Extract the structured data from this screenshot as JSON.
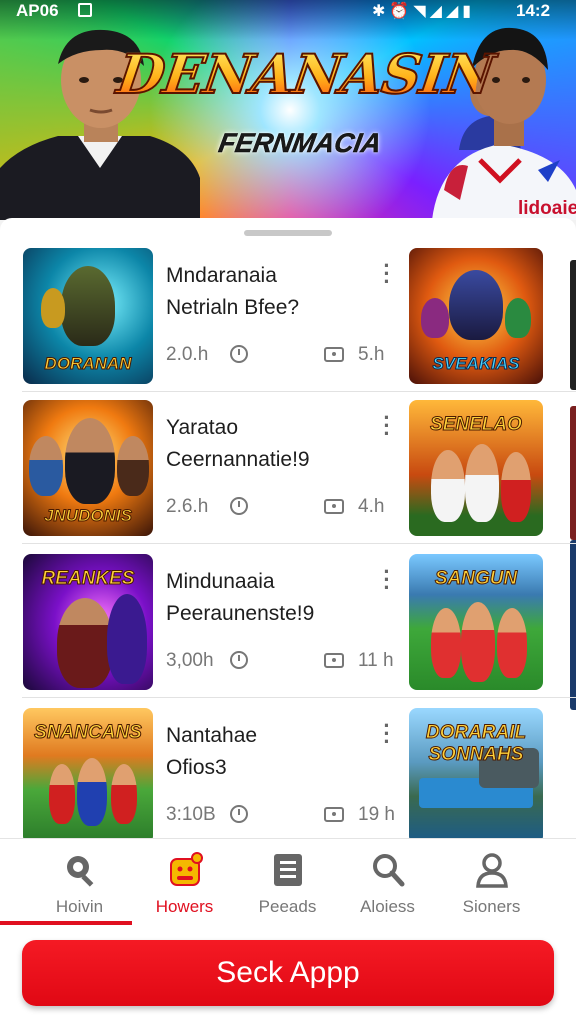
{
  "status_bar": {
    "left_time": "AP06",
    "right_time": "14:2",
    "icons": [
      "bluetooth-icon",
      "alarm-icon",
      "wifi-icon",
      "signal-icon",
      "signal-icon"
    ]
  },
  "hero": {
    "title": "DENANASIN",
    "subtitle": "FERNMACIA",
    "brand": "lidoaie"
  },
  "items": [
    {
      "title": "Mndaranaia",
      "subtitle": "Netrialn Bfee?",
      "meta_left": "2.0.h",
      "meta_right": "5.h",
      "thumb_left_label": "DORANAN",
      "thumb_right_label": "SVEAKIAS"
    },
    {
      "title": "Yaratao",
      "subtitle": "Ceernannatie!9",
      "meta_left": "2.6.h",
      "meta_right": "4.h",
      "thumb_left_label": "JNUDONIS",
      "thumb_right_label": "SENELAO"
    },
    {
      "title": "Mindunaaia",
      "subtitle": "Peeraunenste!9",
      "meta_left": "3,00h",
      "meta_right": "11 h",
      "thumb_left_label": "REANKES",
      "thumb_right_label": "SANGUN"
    },
    {
      "title": "Nantahae",
      "subtitle": "Ofios3",
      "meta_left": "3:10B",
      "meta_right": "19 h",
      "thumb_left_label": "SNANCANS",
      "thumb_right_label": "DORARAIL SONNAHS"
    }
  ],
  "nav": {
    "items": [
      {
        "label": "Hoivin",
        "icon": "gear-search-icon"
      },
      {
        "label": "Howers",
        "icon": "game-character-icon"
      },
      {
        "label": "Peeads",
        "icon": "document-icon"
      },
      {
        "label": "Aloiess",
        "icon": "search-icon"
      },
      {
        "label": "Sioners",
        "icon": "person-icon"
      }
    ],
    "active_index": 1
  },
  "cta": {
    "label": "Seck Appp"
  },
  "colors": {
    "accent": "#e01020",
    "muted_text": "#777777"
  }
}
